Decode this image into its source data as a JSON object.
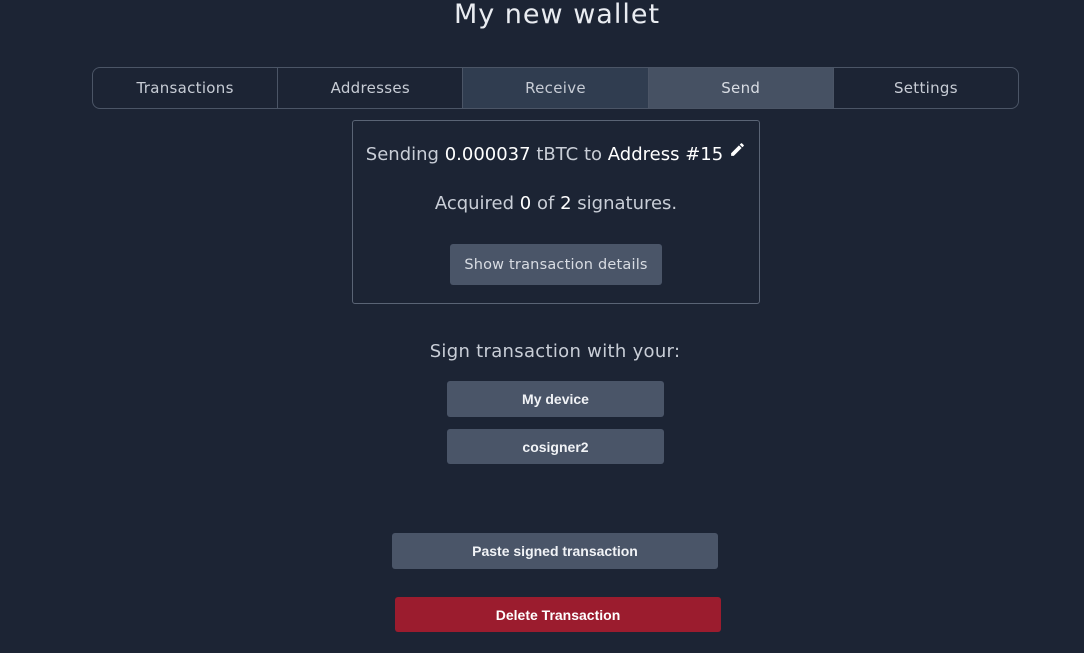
{
  "page": {
    "title": "My new wallet"
  },
  "tabs": [
    {
      "label": "Transactions"
    },
    {
      "label": "Addresses"
    },
    {
      "label": "Receive"
    },
    {
      "label": "Send",
      "active": true
    },
    {
      "label": "Settings"
    }
  ],
  "transaction": {
    "sending_prefix": "Sending",
    "amount": "0.000037",
    "unit": "tBTC",
    "to_word": "to",
    "recipient": "Address #15",
    "edit_icon": "pencil-icon",
    "acquired_prefix": "Acquired",
    "acquired_count": "0",
    "of_word": "of",
    "required_count": "2",
    "signatures_word": "signatures.",
    "details_button": "Show transaction details"
  },
  "signing": {
    "label": "Sign transaction with your:",
    "signers": [
      {
        "label": "My device"
      },
      {
        "label": "cosigner2"
      }
    ]
  },
  "actions": {
    "paste_label": "Paste signed transaction",
    "delete_label": "Delete Transaction"
  },
  "colors": {
    "background": "#1c2434",
    "button_gray": "#4a5568",
    "danger": "#9b1c2e"
  }
}
